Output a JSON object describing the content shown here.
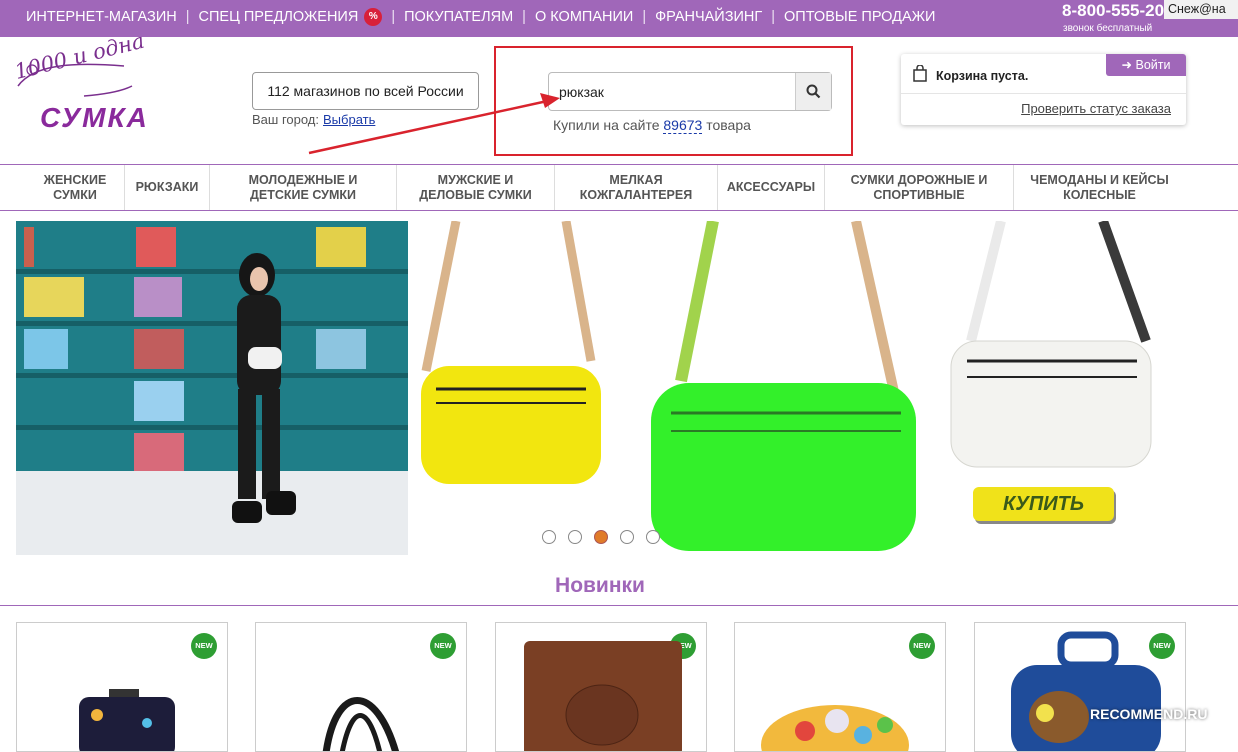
{
  "topbar": {
    "nav": [
      {
        "label": "Интернет-магазин"
      },
      {
        "label": "Спец предложения",
        "badge": "%"
      },
      {
        "label": "Покупателям"
      },
      {
        "label": "О компании"
      },
      {
        "label": "Франчайзинг"
      },
      {
        "label": "Оптовые продажи"
      }
    ],
    "phone": "8-800-555-20",
    "phone_note": "звонок бесплатный",
    "watermark_user": "Снеж@на"
  },
  "logo": {
    "top_text": "1000 и одна",
    "bottom_text": "СУМКА"
  },
  "stores": {
    "label": "112 магазинов по всей России"
  },
  "city": {
    "label": "Ваш город:",
    "link": "Выбрать"
  },
  "search": {
    "value": "рюкзак",
    "bought_prefix": "Купили на сайте",
    "bought_count": "89673",
    "bought_suffix": "товара"
  },
  "cart": {
    "empty_text": "Корзина пуста.",
    "login_label": "Войти",
    "order_status": "Проверить статус заказа"
  },
  "categories": [
    {
      "label": "Женские\nсумки"
    },
    {
      "label": "Рюкзаки"
    },
    {
      "label": "Молодежные и\nдетские сумки"
    },
    {
      "label": "Мужские и\nделовые сумки"
    },
    {
      "label": "Мелкая\nкожгалантерея"
    },
    {
      "label": "Аксессуары"
    },
    {
      "label": "Сумки дорожные и\nспортивные"
    },
    {
      "label": "Чемоданы и кейсы\nколесные"
    }
  ],
  "banner": {
    "buy_label": "КУПИТЬ",
    "slides": 5,
    "active_slide": 3
  },
  "section": {
    "title": "Новинки"
  },
  "products": [
    {
      "badge": "NEW",
      "kind": "suitcase"
    },
    {
      "badge": "NEW",
      "kind": "bag"
    },
    {
      "badge": "NEW",
      "kind": "cover"
    },
    {
      "badge": "NEW",
      "kind": "pouch"
    },
    {
      "badge": "NEW",
      "kind": "kids-suitcase"
    }
  ],
  "watermark_site": "RECOMMEND.RU",
  "colors": {
    "brand": "#a067b9",
    "highlight": "#d9232d",
    "new_badge": "#2e9e33",
    "link": "#1a3aa8"
  }
}
